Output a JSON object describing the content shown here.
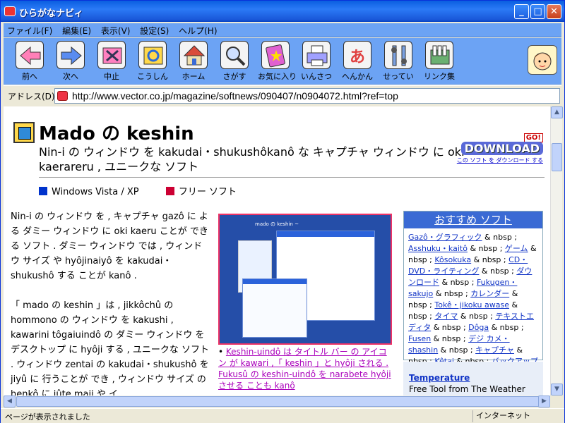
{
  "window": {
    "title": "ひらがなナビィ",
    "min": "_",
    "max": "□",
    "close": "✕"
  },
  "menu": [
    "ファイル(F)",
    "編集(E)",
    "表示(V)",
    "設定(S)",
    "ヘルプ(H)"
  ],
  "toolbar": [
    {
      "label": "前へ",
      "icon": "back-arrow-icon",
      "color": "#ff7fb8"
    },
    {
      "label": "次へ",
      "icon": "forward-arrow-icon",
      "color": "#5a8cf0"
    },
    {
      "label": "中止",
      "icon": "stop-icon",
      "color": "#ff80c0"
    },
    {
      "label": "こうしん",
      "icon": "refresh-icon",
      "color": "#ffd84a"
    },
    {
      "label": "ホーム",
      "icon": "home-icon",
      "color": "#d94b3b"
    },
    {
      "label": "さがす",
      "icon": "search-icon",
      "color": "#8ab0f0"
    },
    {
      "label": "お気に入り",
      "icon": "favorites-icon",
      "color": "#e060d0"
    },
    {
      "label": "いんさつ",
      "icon": "print-icon",
      "color": "#a0a0ff"
    },
    {
      "label": "へんかん",
      "icon": "convert-icon",
      "color": "#e04040"
    },
    {
      "label": "せってい",
      "icon": "settings-icon",
      "color": "#7aa0e0"
    },
    {
      "label": "リンク集",
      "icon": "links-icon",
      "color": "#6ab070"
    }
  ],
  "address": {
    "label": "アドレス(D):",
    "url": "http://www.vector.co.jp/magazine/softnews/090407/n0904072.html?ref=top"
  },
  "page": {
    "title": "Mado の keshin",
    "subtitle": "Nin-i の ウィンドウ を kakudai・shukushôkanô な キャプチャ ウィンドウ に oki kaerareru , ユニークな ソフト",
    "download": {
      "go": "GO!",
      "label": "DOWNLOAD",
      "sub": "この ソフト を ダウンロード する"
    },
    "tags": [
      {
        "label": "Windows Vista / XP",
        "color": "#0033cc"
      },
      {
        "label": "フリー ソフト",
        "color": "#cc0033"
      }
    ],
    "body": "Nin-i の ウィンドウ を , キャプチャ gazô に よる ダミー ウィンドウ に oki kaeru ことが できる ソフト . ダミー ウィンドウ では , ウィンドウ サイズ や hyôjinaiyô を kakudai・shukushô する ことが kanô .",
    "body2": "「 mado の keshin 」は , jikkôchû の hommono の ウィンドウ を kakushi , kawarini tôgaiuindô の ダミー ウィンドウ を デスクトップ に hyôji する , ユニークな ソフト . ウィンドウ zentai の kakudai・shukushô を jiyû に 行うことが でき , ウィンドウ サイズ の henkô に jûte maji や イ",
    "screenshot_title": "mado の keshin ~",
    "caption": "Keshin-uindô は タイトル バー の アイコン が kawari ,「 keshin 」と hyôji される . Fukusû の keshin-uindô を narabete hyôji させる ことも kanô",
    "side_title": "おすすめ ソフト",
    "side_items": [
      "Gazô・グラフィック",
      "Asshuku・kaitô",
      "ゲーム",
      "Kôsokuka",
      "CD・DVD・ライティング",
      "ダウンロード",
      "Fukugen・sakujo",
      "カレンダー",
      "Tokê・jikoku awase",
      "タイマ",
      "テキストエディタ",
      "Dôga",
      "Fusen",
      "デジ カメ・shashin",
      "キャプチャ",
      "Kêtai",
      "バックアップ"
    ],
    "nbsp": "& nbsp ;",
    "side2_title": "Temperature",
    "side2_desc": "Free Tool from The Weather"
  },
  "status": {
    "text": "ページが表示されました",
    "zone": "インターネット"
  }
}
